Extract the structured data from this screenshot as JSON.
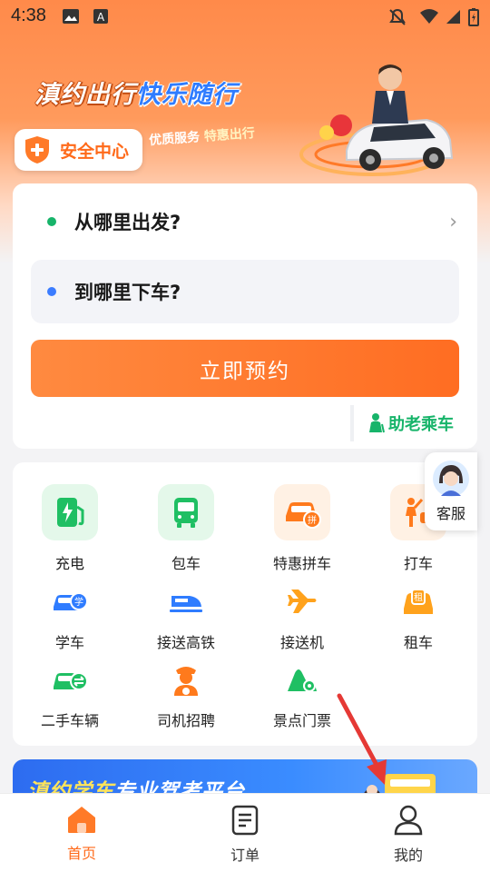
{
  "status_bar": {
    "time": "4:38"
  },
  "banner": {
    "slogan_part1": "滇约出行",
    "slogan_part2": "快乐随行",
    "subtitle_part1": "优质服务",
    "subtitle_part2": "特惠出行"
  },
  "safety_center": {
    "label": "安全中心"
  },
  "trip": {
    "from_label": "从哪里出发?",
    "to_label": "到哪里下车?",
    "book_label": "立即预约",
    "elderly_label": "助老乘车",
    "from_dot_color": "#17b46a",
    "to_dot_color": "#3b7cff"
  },
  "services": [
    {
      "label": "充电",
      "icon": "charging-station-icon"
    },
    {
      "label": "包车",
      "icon": "bus-icon"
    },
    {
      "label": "特惠拼车",
      "icon": "carpool-icon"
    },
    {
      "label": "打车",
      "icon": "taxi-hail-icon"
    },
    {
      "label": "学车",
      "icon": "driving-school-icon"
    },
    {
      "label": "接送高铁",
      "icon": "high-speed-rail-icon"
    },
    {
      "label": "接送机",
      "icon": "airplane-icon"
    },
    {
      "label": "租车",
      "icon": "car-rental-icon"
    },
    {
      "label": "二手车辆",
      "icon": "used-car-icon"
    },
    {
      "label": "司机招聘",
      "icon": "driver-recruit-icon"
    },
    {
      "label": "景点门票",
      "icon": "scenic-ticket-icon"
    }
  ],
  "customer_service": {
    "label": "客服"
  },
  "promo": {
    "text_part1": "滇约学车",
    "text_part2": "专业驾考平台"
  },
  "tabbar": [
    {
      "label": "首页",
      "icon": "home-icon",
      "active": true
    },
    {
      "label": "订单",
      "icon": "orders-icon",
      "active": false
    },
    {
      "label": "我的",
      "icon": "profile-icon",
      "active": false
    }
  ],
  "colors": {
    "accent": "#ff6a1a",
    "green": "#17b46a",
    "blue": "#3b7cff"
  }
}
